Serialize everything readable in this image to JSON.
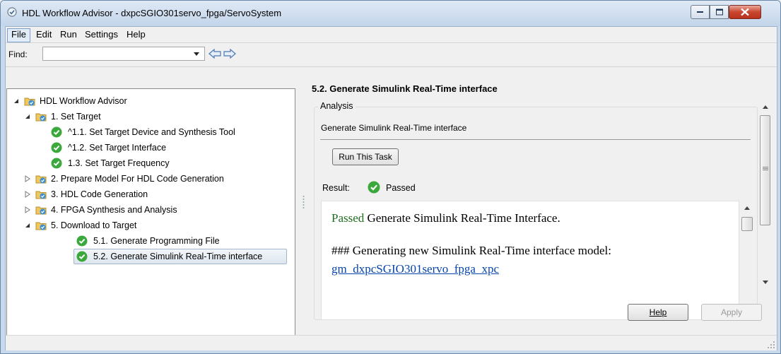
{
  "window": {
    "title": "HDL Workflow Advisor - dxpcSGIO301servo_fpga/ServoSystem"
  },
  "menu": {
    "items": [
      "File",
      "Edit",
      "Run",
      "Settings",
      "Help"
    ],
    "active": "File"
  },
  "find": {
    "label": "Find:",
    "value": ""
  },
  "tree": {
    "root": "HDL Workflow Advisor",
    "items": [
      {
        "label": "1. Set Target",
        "kind": "folder",
        "expanded": true,
        "level": 1
      },
      {
        "label": "^1.1. Set Target Device and Synthesis Tool",
        "kind": "task-passed",
        "level": 2
      },
      {
        "label": "^1.2. Set Target Interface",
        "kind": "task-passed",
        "level": 2
      },
      {
        "label": "1.3. Set Target Frequency",
        "kind": "task-passed",
        "level": 2
      },
      {
        "label": "2. Prepare Model For HDL Code Generation",
        "kind": "folder",
        "expanded": false,
        "level": 1
      },
      {
        "label": "3. HDL Code Generation",
        "kind": "folder",
        "expanded": false,
        "level": 1
      },
      {
        "label": "4. FPGA Synthesis and Analysis",
        "kind": "folder",
        "expanded": false,
        "level": 1
      },
      {
        "label": "5. Download to Target",
        "kind": "folder",
        "expanded": true,
        "level": 1
      },
      {
        "label": "5.1. Generate Programming File",
        "kind": "task-passed",
        "level": 2
      },
      {
        "label": "5.2. Generate Simulink Real-Time interface",
        "kind": "task-passed",
        "level": 2,
        "selected": true
      }
    ]
  },
  "details": {
    "title": "5.2. Generate Simulink Real-Time interface",
    "group_label": "Analysis",
    "description": "Generate Simulink Real-Time interface",
    "run_button": "Run This Task",
    "result_label": "Result:",
    "result_value": "Passed",
    "output": {
      "line1_status": "Passed",
      "line1_text": " Generate Simulink Real-Time Interface.",
      "line2": "### Generating new Simulink Real-Time interface model:",
      "link": "gm_dxpcSGIO301servo_fpga_xpc"
    }
  },
  "buttons": {
    "help": "Help",
    "apply": "Apply"
  },
  "colors": {
    "pass_green": "#3aa83a",
    "link_blue": "#0645ad",
    "passed_text": "#1f6e1f"
  }
}
